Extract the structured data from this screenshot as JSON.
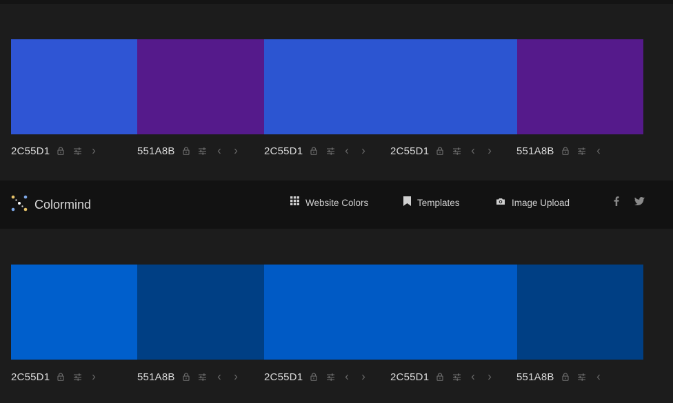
{
  "colors": {
    "page_bg": "#1c1c1c",
    "nav_bg": "#121212",
    "icon_gray": "#6a6a6a",
    "hex_text": "#d9d9d9"
  },
  "palettes": [
    {
      "segments": [
        {
          "color": "#2f55d4",
          "weight": 1
        },
        {
          "color": "#551a8b",
          "weight": 1
        },
        {
          "color": "#2c55d1",
          "weight": 2
        },
        {
          "color": "#551a8b",
          "weight": 1
        }
      ],
      "labels": [
        {
          "hex": "2C55D1",
          "prev": false,
          "next": true
        },
        {
          "hex": "551A8B",
          "prev": true,
          "next": true
        },
        {
          "hex": "2C55D1",
          "prev": true,
          "next": true
        },
        {
          "hex": "2C55D1",
          "prev": true,
          "next": true
        },
        {
          "hex": "551A8B",
          "prev": true,
          "next": false
        }
      ]
    },
    {
      "segments": [
        {
          "color": "#005fcc",
          "weight": 1
        },
        {
          "color": "#003f84",
          "weight": 1
        },
        {
          "color": "#005ac5",
          "weight": 2
        },
        {
          "color": "#003f84",
          "weight": 1
        }
      ],
      "labels": [
        {
          "hex": "2C55D1",
          "prev": false,
          "next": true
        },
        {
          "hex": "551A8B",
          "prev": true,
          "next": true
        },
        {
          "hex": "2C55D1",
          "prev": true,
          "next": true
        },
        {
          "hex": "2C55D1",
          "prev": true,
          "next": true
        },
        {
          "hex": "551A8B",
          "prev": true,
          "next": false
        }
      ]
    }
  ],
  "nav": {
    "brand": "Colormind",
    "items": [
      {
        "label": "Website Colors",
        "icon": "grid-icon"
      },
      {
        "label": "Templates",
        "icon": "bookmark-icon"
      },
      {
        "label": "Image Upload",
        "icon": "camera-icon"
      }
    ],
    "social": [
      {
        "icon": "facebook-icon"
      },
      {
        "icon": "twitter-icon"
      }
    ]
  }
}
